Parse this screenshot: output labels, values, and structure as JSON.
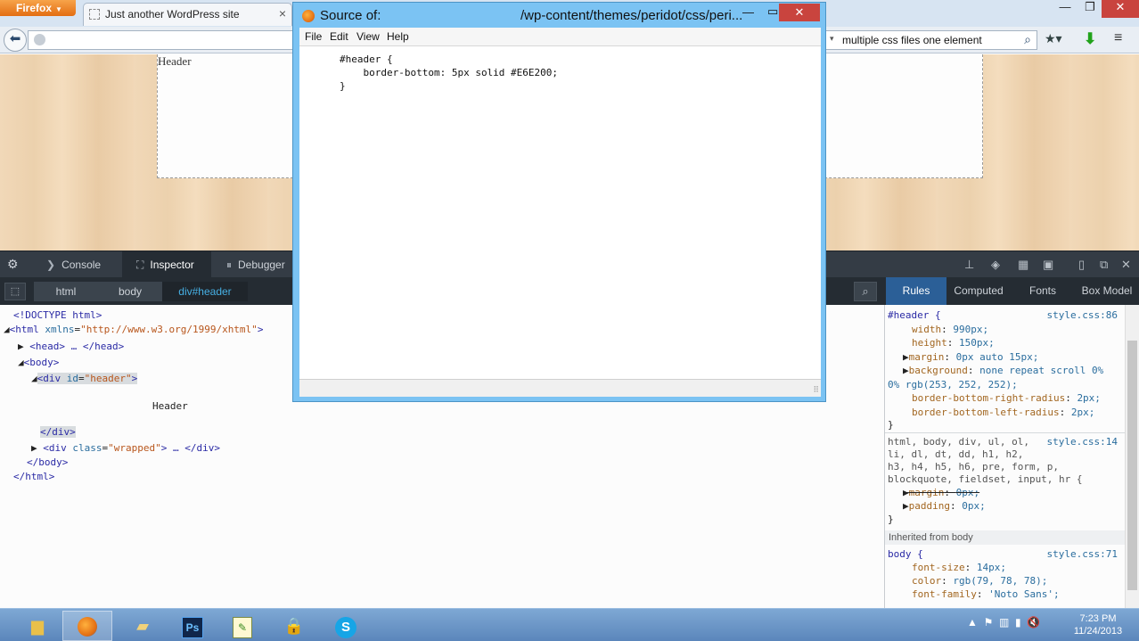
{
  "browser": {
    "menu_label": "Firefox",
    "tab_title": "Just another WordPress site",
    "tab_close": "×",
    "window_min": "—",
    "window_max": "❐",
    "window_close": "✕",
    "search_value": "multiple css files one element"
  },
  "page": {
    "header_text": "Header"
  },
  "source_window": {
    "title": "Source of:",
    "path": "/wp-content/themes/peridot/css/peri...",
    "menu": [
      "File",
      "Edit",
      "View",
      "Help"
    ],
    "code_lines": [
      "#header {",
      "    border-bottom: 5px solid #E6E200;",
      "}"
    ]
  },
  "devtools": {
    "tabs": {
      "console": "Console",
      "inspector": "Inspector",
      "debugger": "Debugger"
    },
    "breadcrumbs": [
      "html",
      "body",
      "div#header"
    ],
    "side_tabs": [
      "Rules",
      "Computed",
      "Fonts",
      "Box Model"
    ],
    "markup": {
      "doctype": "<!DOCTYPE html>",
      "html_open": "<html",
      "html_attr": "xmlns",
      "html_val": "\"http://www.w3.org/1999/xhtml\"",
      "head": "<head> … </head>",
      "body_open": "<body>",
      "div_open_tag": "<div",
      "div_attr": "id",
      "div_val": "\"header\"",
      "div_text": "Header",
      "div_close": "</div>",
      "wrapped_open": "<div",
      "wrapped_attr": "class",
      "wrapped_val": "\"wrapped\"",
      "wrapped_rest": "> … </div>",
      "body_close": "</body>",
      "html_close": "</html>"
    },
    "rules": {
      "r1_selector": "#header {",
      "r1_source": "style.css:86",
      "r1_props": [
        {
          "name": "width",
          "value": "990px;"
        },
        {
          "name": "height",
          "value": "150px;"
        },
        {
          "name": "margin",
          "value": "0px auto 15px;"
        },
        {
          "name": "background",
          "value": "none repeat scroll 0%"
        },
        {
          "name": "",
          "value": "0% rgb(253, 252, 252);"
        },
        {
          "name": "border-bottom-right-radius",
          "value": "2px;"
        },
        {
          "name": "border-bottom-left-radius",
          "value": "2px;"
        }
      ],
      "close_brace": "}",
      "r2_selector_lines": [
        "html, body, div, ul, ol,",
        "li, dl, dt, dd, h1, h2,",
        "h3, h4, h5, h6, pre, form, p,",
        "blockquote, fieldset, input, hr {"
      ],
      "r2_source": "style.css:14",
      "r2_props": [
        {
          "name": "margin",
          "value": "0px;"
        },
        {
          "name": "padding",
          "value": "0px;"
        }
      ],
      "inherited_label": "Inherited from body",
      "r3_selector": "body {",
      "r3_source": "style.css:71",
      "r3_props": [
        {
          "name": "font-size",
          "value": "14px;"
        },
        {
          "name": "color",
          "value": "rgb(79, 78, 78);"
        },
        {
          "name": "font-family",
          "value": "'Noto Sans';"
        }
      ]
    }
  },
  "taskbar": {
    "time": "7:23 PM",
    "date": "11/24/2013",
    "ps_label": "Ps",
    "skype_label": "S"
  }
}
